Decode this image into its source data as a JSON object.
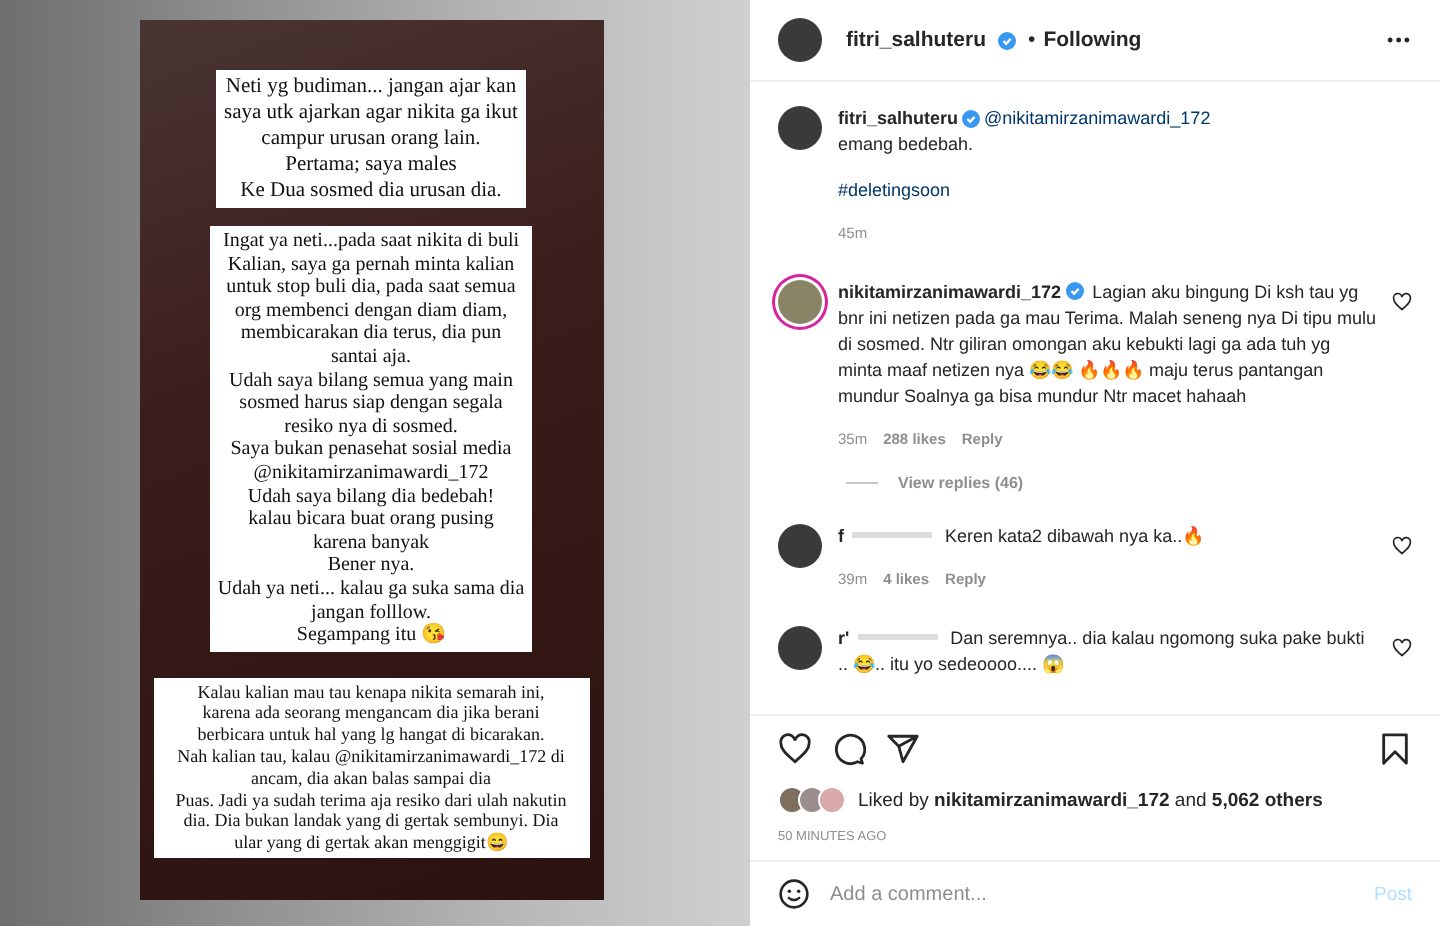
{
  "story": {
    "boxes": [
      {
        "lines": [
          "Neti yg budiman... jangan ajar kan",
          "saya utk ajarkan agar nikita ga ikut",
          "campur urusan orang lain.",
          "Pertama; saya males",
          "Ke Dua sosmed dia urusan dia."
        ]
      },
      {
        "lines": [
          "Ingat ya neti...pada saat nikita di buli",
          "Kalian, saya ga pernah minta kalian",
          "untuk stop buli dia, pada saat semua",
          "org membenci dengan diam diam,",
          "membicarakan dia terus, dia pun",
          "santai aja.",
          "Udah saya bilang semua yang main",
          "sosmed harus siap dengan segala",
          "resiko nya di sosmed.",
          "Saya bukan penasehat sosial media",
          "@nikitamirzanimawardi_172",
          "Udah saya bilang dia bedebah!",
          "kalau bicara buat orang pusing",
          "karena banyak",
          "Bener nya.",
          "Udah ya neti... kalau ga suka sama dia",
          "jangan folllow.",
          "Segampang itu 😘"
        ]
      },
      {
        "lines": [
          "Kalau kalian mau tau kenapa nikita semarah ini,",
          "karena ada seorang mengancam dia jika berani",
          "berbicara untuk hal yang lg hangat di bicarakan.",
          "Nah kalian tau, kalau @nikitamirzanimawardi_172 di",
          "ancam, dia akan balas sampai dia",
          "Puas. Jadi ya sudah terima aja resiko dari ulah nakutin",
          "dia. Dia bukan landak yang di gertak sembunyi. Dia",
          "ular yang di gertak akan menggigit😄"
        ]
      }
    ]
  },
  "header": {
    "username": "fitri_salhuteru",
    "verified": true,
    "separator": "•",
    "follow_status": "Following",
    "more": "•••"
  },
  "caption": {
    "username": "fitri_salhuteru",
    "verified": true,
    "mention": "@nikitamirzanimawardi_172",
    "text": "emang bedebah.",
    "hashtag": "#deletingsoon",
    "time": "45m"
  },
  "comments": [
    {
      "username": "nikitamirzanimawardi_172",
      "verified": true,
      "redacted": false,
      "story_ring": true,
      "text": "Lagian aku bingung Di ksh tau yg bnr ini netizen pada ga mau Terima. Malah seneng nya Di tipu mulu di sosmed. Ntr giliran omongan aku kebukti lagi ga ada tuh yg minta maaf netizen nya 😂😂 🔥🔥🔥 maju terus pantangan mundur Soalnya ga bisa mundur Ntr macet hahaah",
      "time": "35m",
      "likes": "288 likes",
      "reply": "Reply",
      "view_replies": "View replies (46)"
    },
    {
      "username": "f",
      "verified": false,
      "redacted": true,
      "story_ring": false,
      "text": "Keren kata2 dibawah nya ka..🔥",
      "time": "39m",
      "likes": "4 likes",
      "reply": "Reply"
    },
    {
      "username": "r'",
      "verified": false,
      "redacted": true,
      "story_ring": false,
      "text": "Dan seremnya.. dia kalau ngomong suka pake bukti .. 😂.. itu yo sedeoooo.... 😱"
    }
  ],
  "liked_by": {
    "prefix": "Liked by",
    "user": "nikitamirzanimawardi_172",
    "middle": "and",
    "others": "5,062 others"
  },
  "posted": "50 MINUTES AGO",
  "add_comment": {
    "placeholder": "Add a comment...",
    "post": "Post",
    "post_disabled": true
  }
}
